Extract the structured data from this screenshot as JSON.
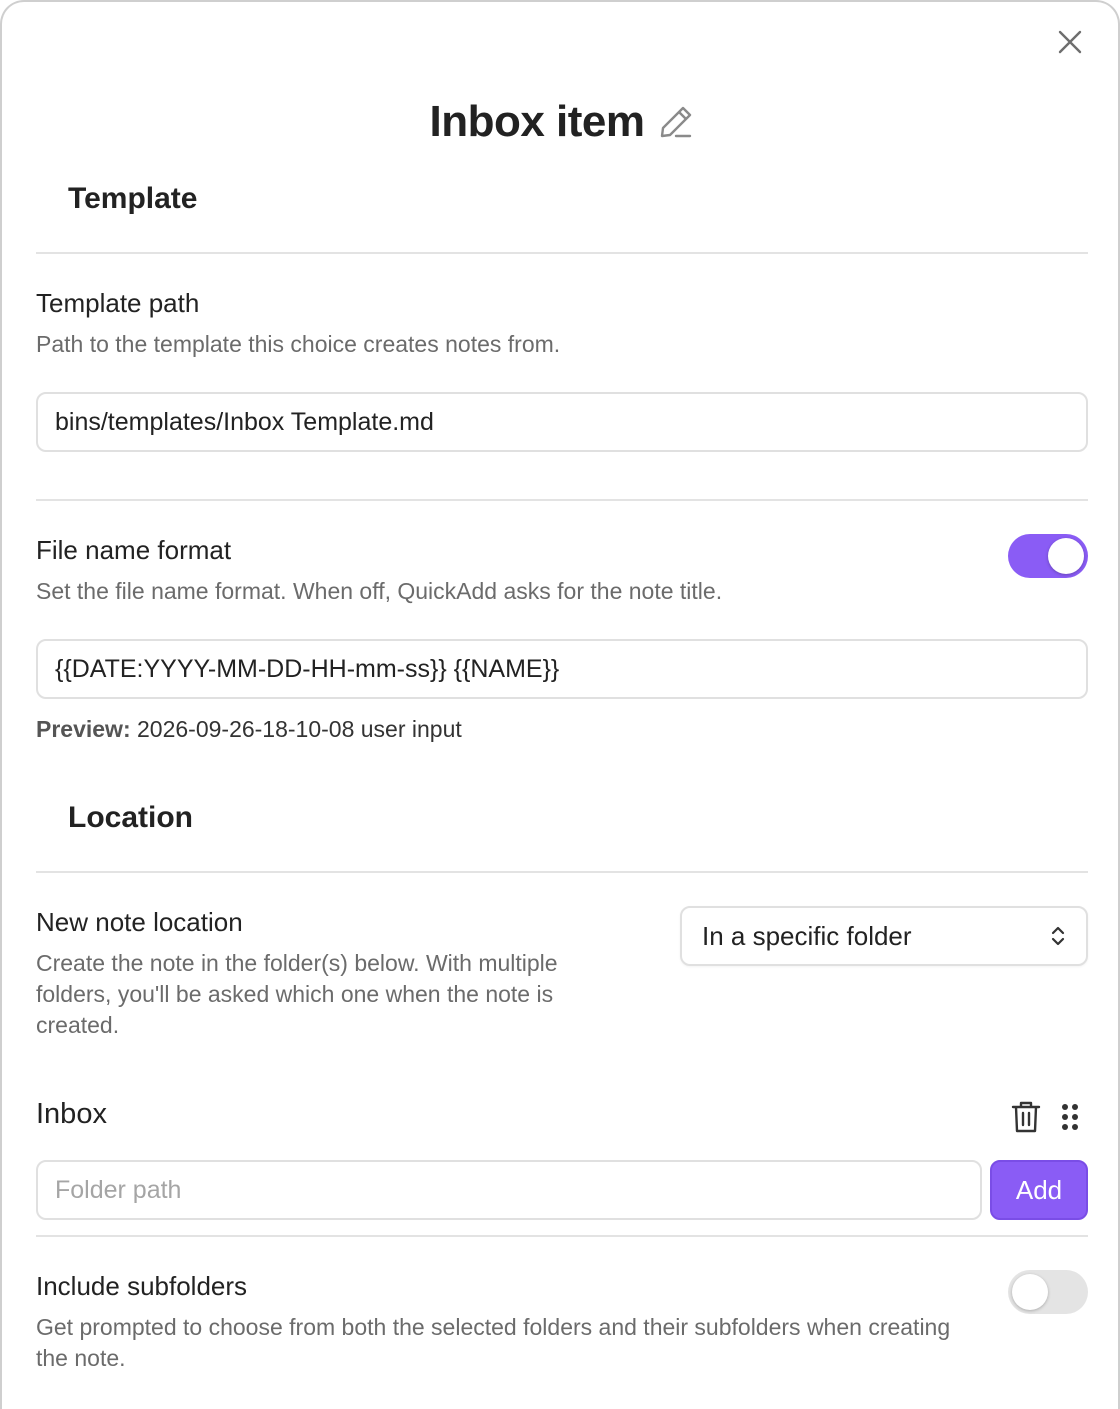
{
  "dialog": {
    "title": "Inbox item",
    "close_icon": "close-icon",
    "edit_icon": "pencil-icon"
  },
  "template_section": {
    "heading": "Template",
    "template_path": {
      "name": "Template path",
      "description": "Path to the template this choice creates notes from.",
      "value": "bins/templates/Inbox Template.md"
    },
    "file_name_format": {
      "name": "File name format",
      "description": "Set the file name format. When off, QuickAdd asks for the note title.",
      "enabled": true,
      "value": "{{DATE:YYYY-MM-DD-HH-mm-ss}} {{NAME}}",
      "preview_label": "Preview:",
      "preview_value": "2026-09-26-18-10-08 user input"
    }
  },
  "location_section": {
    "heading": "Location",
    "new_note_location": {
      "name": "New note location",
      "description": "Create the note in the folder(s) below. With multiple folders, you'll be asked which one when the note is created.",
      "selected": "In a specific folder"
    },
    "folders": {
      "label": "Inbox",
      "delete_icon": "trash-icon",
      "drag_icon": "drag-handle-icon",
      "input_placeholder": "Folder path",
      "add_label": "Add"
    },
    "include_subfolders": {
      "name": "Include subfolders",
      "description": "Get prompted to choose from both the selected folders and their subfolders when creating the note.",
      "enabled": false
    }
  },
  "colors": {
    "accent": "#8a5cf5",
    "toggle_off": "#e4e4e4",
    "muted_text": "#6b6b6b"
  }
}
